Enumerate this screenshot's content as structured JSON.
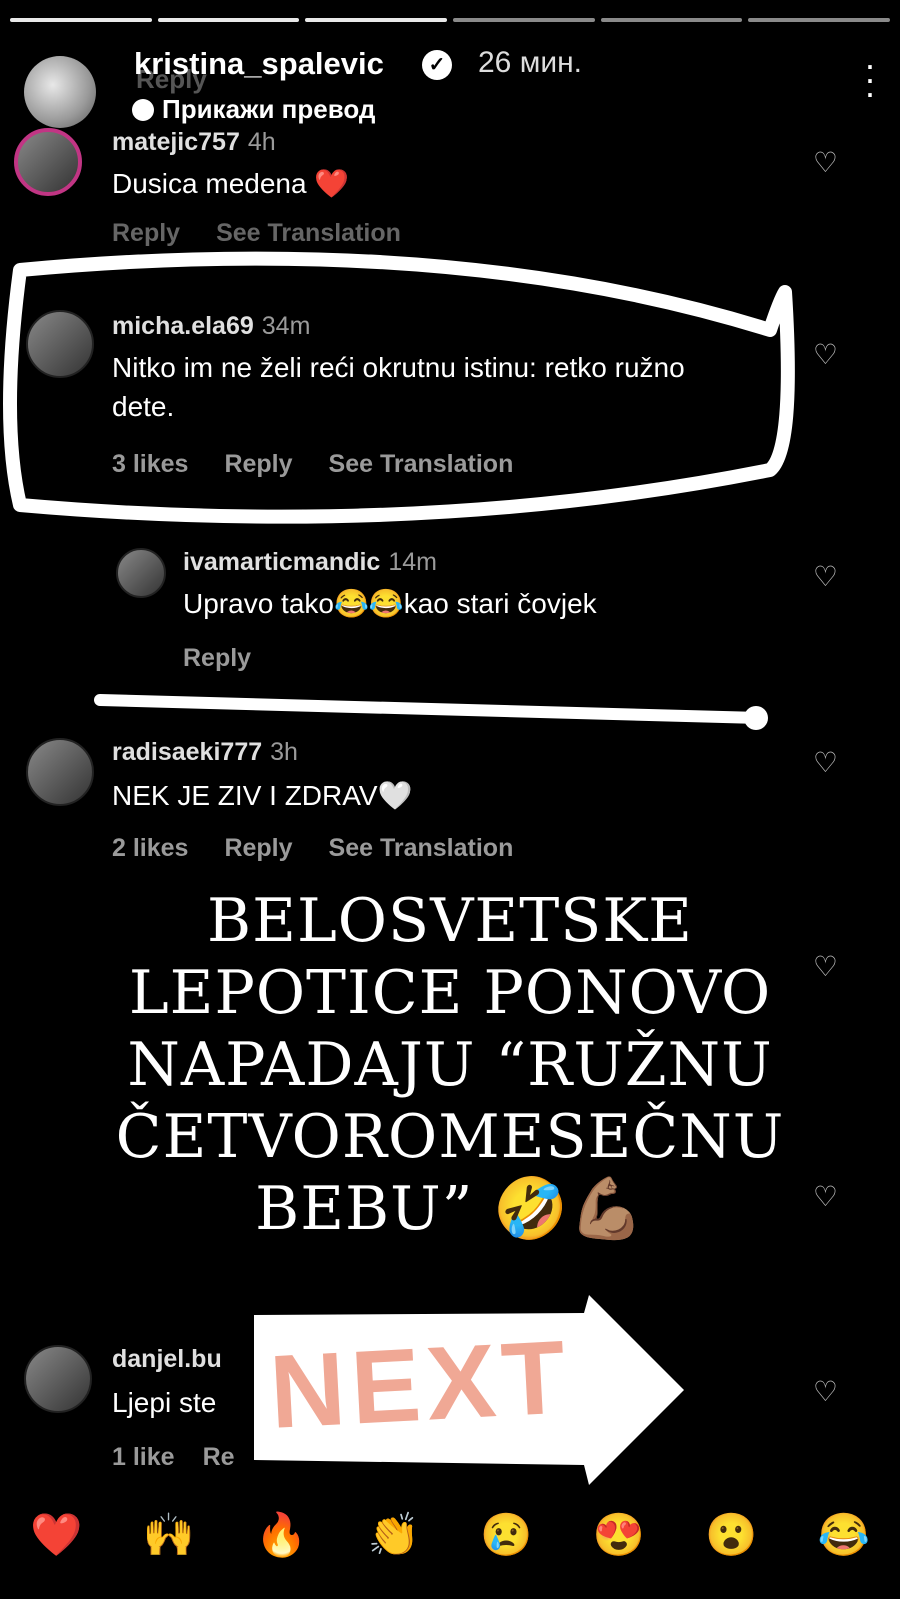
{
  "story": {
    "username": "kristina_spalevic",
    "time": "26 мин.",
    "translate_label": "Прикажи превод",
    "ghost_reply": "Reply",
    "menu_icon": "more-vertical-icon"
  },
  "comments": [
    {
      "user": "matejic757",
      "ago": "4h",
      "text": "Dusica medena ❤️",
      "likes": "",
      "reply": "Reply",
      "translation": "See Translation"
    },
    {
      "user": "micha.ela69",
      "ago": "34m",
      "text": "Nitko im ne želi reći okrutnu istinu: retko ružno dete.",
      "likes": "3 likes",
      "reply": "Reply",
      "translation": "See Translation"
    },
    {
      "user": "ivamarticmandic",
      "ago": "14m",
      "text": "Upravo tako😂😂kao stari čovjek",
      "likes": "",
      "reply": "Reply",
      "translation": ""
    },
    {
      "user": "radisaeki777",
      "ago": "3h",
      "text": "NEK JE ZIV I ZDRAV🤍",
      "likes": "2 likes",
      "reply": "Reply",
      "translation": "See Translation"
    },
    {
      "user": "danjel.bu",
      "ago": "",
      "text": "Ljepi ste",
      "likes": "1 like",
      "reply": "Re",
      "translation": ""
    }
  ],
  "overlay": {
    "line1": "BELOSVETSKE",
    "line2": "LEPOTICE PONOVO",
    "line3": "NAPADAJU “RUŽNU",
    "line4": "ČETVOROMESEČNU",
    "line5": "BEBU” 🤣💪🏽",
    "sticker": "NEXT"
  },
  "reactions": [
    "❤️",
    "🙌",
    "🔥",
    "👏",
    "😢",
    "😍",
    "😮",
    "😂"
  ]
}
